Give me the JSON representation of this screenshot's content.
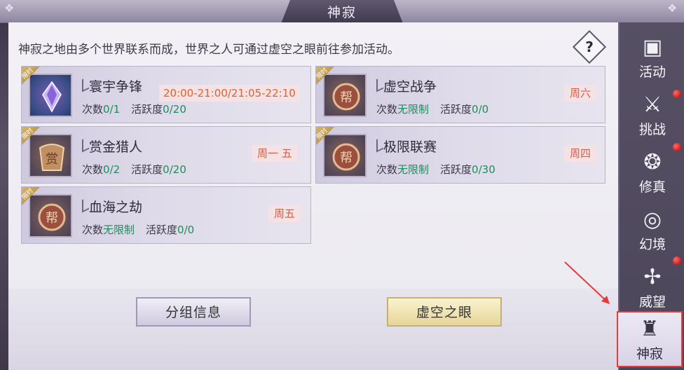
{
  "window": {
    "title": "神寂"
  },
  "description": "神寂之地由多个世界联系而成，世界之人可通过虚空之眼前往参加活动。",
  "help_label": "?",
  "limited_tag": "限时",
  "activities": [
    {
      "name": "寰宇争锋",
      "icon": "crystal-icon",
      "limited": true,
      "time": "20:00-21:00/21:05-22:10",
      "count_label": "次数",
      "count_value": "0/1",
      "activity_label": "活跃度",
      "activity_value": "0/20"
    },
    {
      "name": "虚空战争",
      "icon": "bang-emblem-icon",
      "limited": true,
      "day": "周六",
      "count_label": "次数",
      "count_value": "无限制",
      "activity_label": "活跃度",
      "activity_value": "0/0"
    },
    {
      "name": "赏金猎人",
      "icon": "bounty-emblem-icon",
      "limited": true,
      "day": "周一 五",
      "count_label": "次数",
      "count_value": "0/2",
      "activity_label": "活跃度",
      "activity_value": "0/20"
    },
    {
      "name": "极限联赛",
      "icon": "bang-emblem-icon",
      "limited": true,
      "day": "周四",
      "count_label": "次数",
      "count_value": "无限制",
      "activity_label": "活跃度",
      "activity_value": "0/30"
    },
    {
      "name": "血海之劫",
      "icon": "bang-emblem-icon",
      "limited": true,
      "day": "周五",
      "count_label": "次数",
      "count_value": "无限制",
      "activity_label": "活跃度",
      "activity_value": "0/0"
    }
  ],
  "buttons": {
    "group_info": "分组信息",
    "void_eye": "虚空之眼"
  },
  "sidebar": {
    "items": [
      {
        "label": "活动",
        "icon": "activity-icon",
        "dot": false
      },
      {
        "label": "挑战",
        "icon": "challenge-icon",
        "dot": true
      },
      {
        "label": "修真",
        "icon": "cultivation-icon",
        "dot": true
      },
      {
        "label": "幻境",
        "icon": "illusion-icon",
        "dot": true
      },
      {
        "label": "威望",
        "icon": "prestige-icon",
        "dot": false
      },
      {
        "label": "神寂",
        "icon": "shenji-icon",
        "dot": false,
        "selected": true
      }
    ]
  },
  "colors": {
    "time_text": "#e1612f",
    "day_text": "#e15a3e",
    "unlimited_text": "#1e8d5b",
    "selected_outline": "#e43b3b"
  }
}
